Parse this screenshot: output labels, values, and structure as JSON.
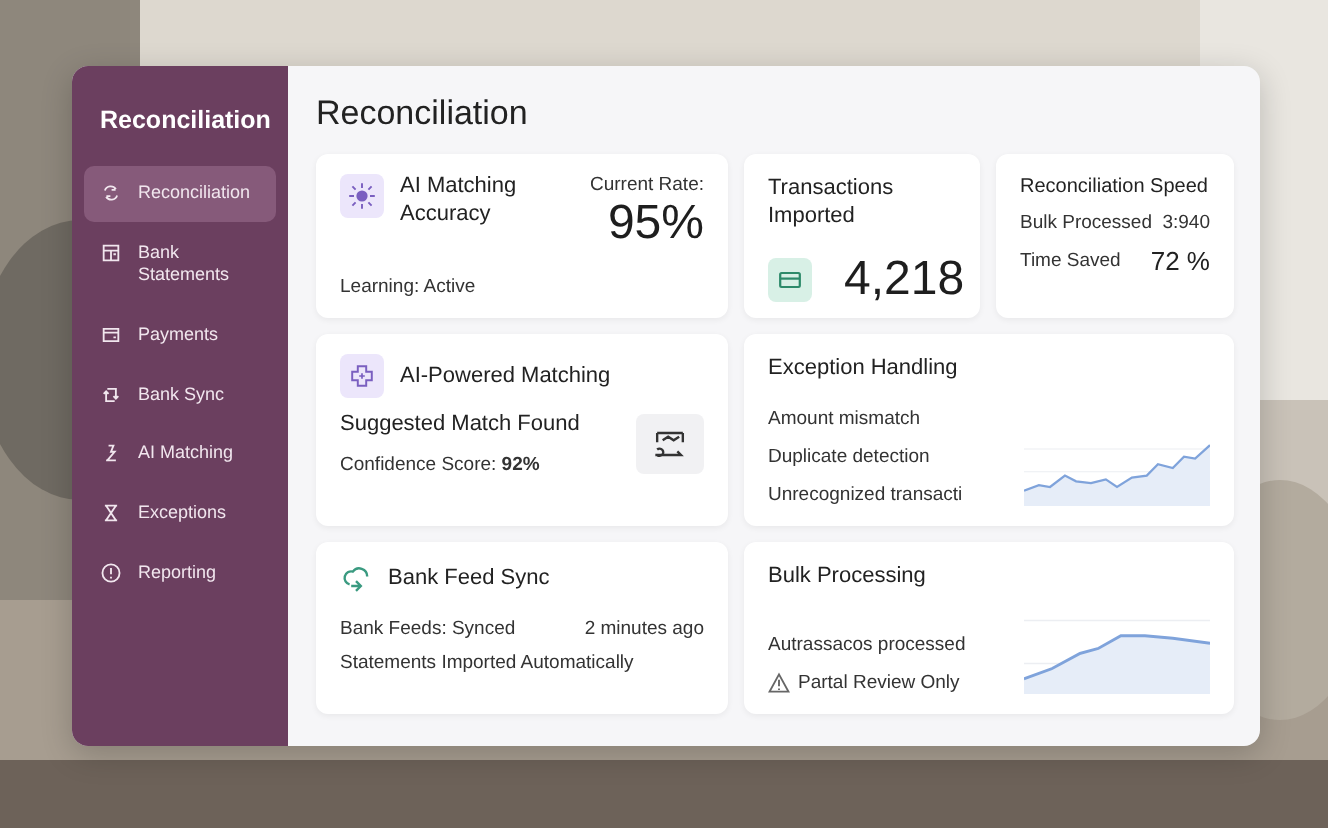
{
  "sidebar": {
    "title": "Reconciliation",
    "items": [
      {
        "label": "Reconciliation",
        "selected": true
      },
      {
        "label": "Bank Statements",
        "selected": false
      },
      {
        "label": "Payments",
        "selected": false
      },
      {
        "label": "Bank Sync",
        "selected": false
      },
      {
        "label": "AI Matching",
        "selected": false
      },
      {
        "label": "Exceptions",
        "selected": false
      },
      {
        "label": "Reporting",
        "selected": false
      }
    ]
  },
  "main": {
    "title": "Reconciliation",
    "accuracy": {
      "title": "AI Matching Accuracy",
      "rate_label": "Current Rate:",
      "rate": "95%",
      "status": "Learning: Active"
    },
    "imported": {
      "title": "Transactions Imported",
      "value": "4,218"
    },
    "speed": {
      "title": "Reconciliation Speed",
      "rows": [
        {
          "label": "Bulk Processed",
          "value": "3:940"
        },
        {
          "label": "Time Saved",
          "value": "72 %"
        }
      ]
    },
    "matching": {
      "title": "AI-Powered Matching",
      "headline": "Suggested Match Found",
      "confidence_label": "Confidence Score:",
      "confidence": "92%"
    },
    "exceptions": {
      "title": "Exception Handling",
      "items": [
        "Amount mismatch",
        "Duplicate detection",
        "Unrecognized transacti"
      ]
    },
    "sync": {
      "title": "Bank Feed Sync",
      "status": "Bank Feeds: Synced",
      "time": "2 minutes ago",
      "note": "Statements Imported Automatically"
    },
    "bulk": {
      "title": "Bulk Processing",
      "processed": "Autrassacos processed",
      "warning": "Partal Review Only"
    }
  }
}
